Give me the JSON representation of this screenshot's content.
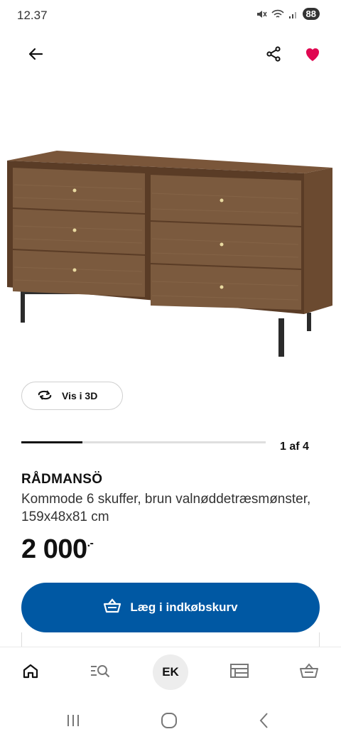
{
  "status_bar": {
    "time": "12.37",
    "battery": "88"
  },
  "gallery": {
    "view_3d_label": "Vis i 3D",
    "counter": "1 af 4",
    "progress": 0.25
  },
  "product": {
    "name": "RÅDMANSÖ",
    "description": "Kommode 6 skuffer, brun valnøddetræsmønster, 159x48x81 cm",
    "price_main": "2 000",
    "price_suffix": ".-"
  },
  "actions": {
    "add_to_cart_label": "Læg i indkøbskurv"
  },
  "bottom_nav": {
    "account_initials": "EK",
    "items": [
      "home-icon",
      "search-icon",
      "account-avatar",
      "store-icon",
      "basket-icon"
    ]
  },
  "colors": {
    "brand_blue": "#0058a3",
    "favourite_red": "#e00751"
  }
}
